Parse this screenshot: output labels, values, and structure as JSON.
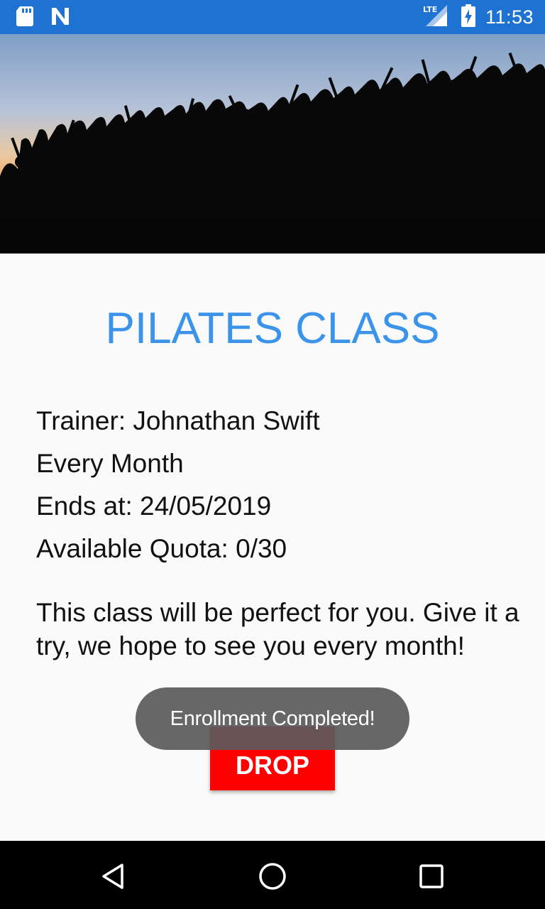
{
  "status_bar": {
    "time": "11:53",
    "network_label": "LTE",
    "icons": [
      "sd-card-icon",
      "n-notification-icon",
      "lte-signal-icon",
      "battery-charging-icon"
    ],
    "background_color": "#1e73d2"
  },
  "hero": {
    "icon": "crowd-sunset-photo"
  },
  "class": {
    "title": "PILATES CLASS",
    "trainer": "Trainer: Johnathan Swift",
    "frequency": "Every Month",
    "ends_at": "Ends at: 24/05/2019",
    "quota": "Available Quota: 0/30",
    "description": "This class will be perfect for you. Give it a try, we hope to see you every month!",
    "title_color": "#3b94ea"
  },
  "actions": {
    "drop_label": "DROP",
    "drop_color": "#ff0000"
  },
  "toast": {
    "message": "Enrollment Completed!"
  },
  "nav_bar": {
    "icons": [
      "back-icon",
      "home-icon",
      "recents-icon"
    ]
  }
}
